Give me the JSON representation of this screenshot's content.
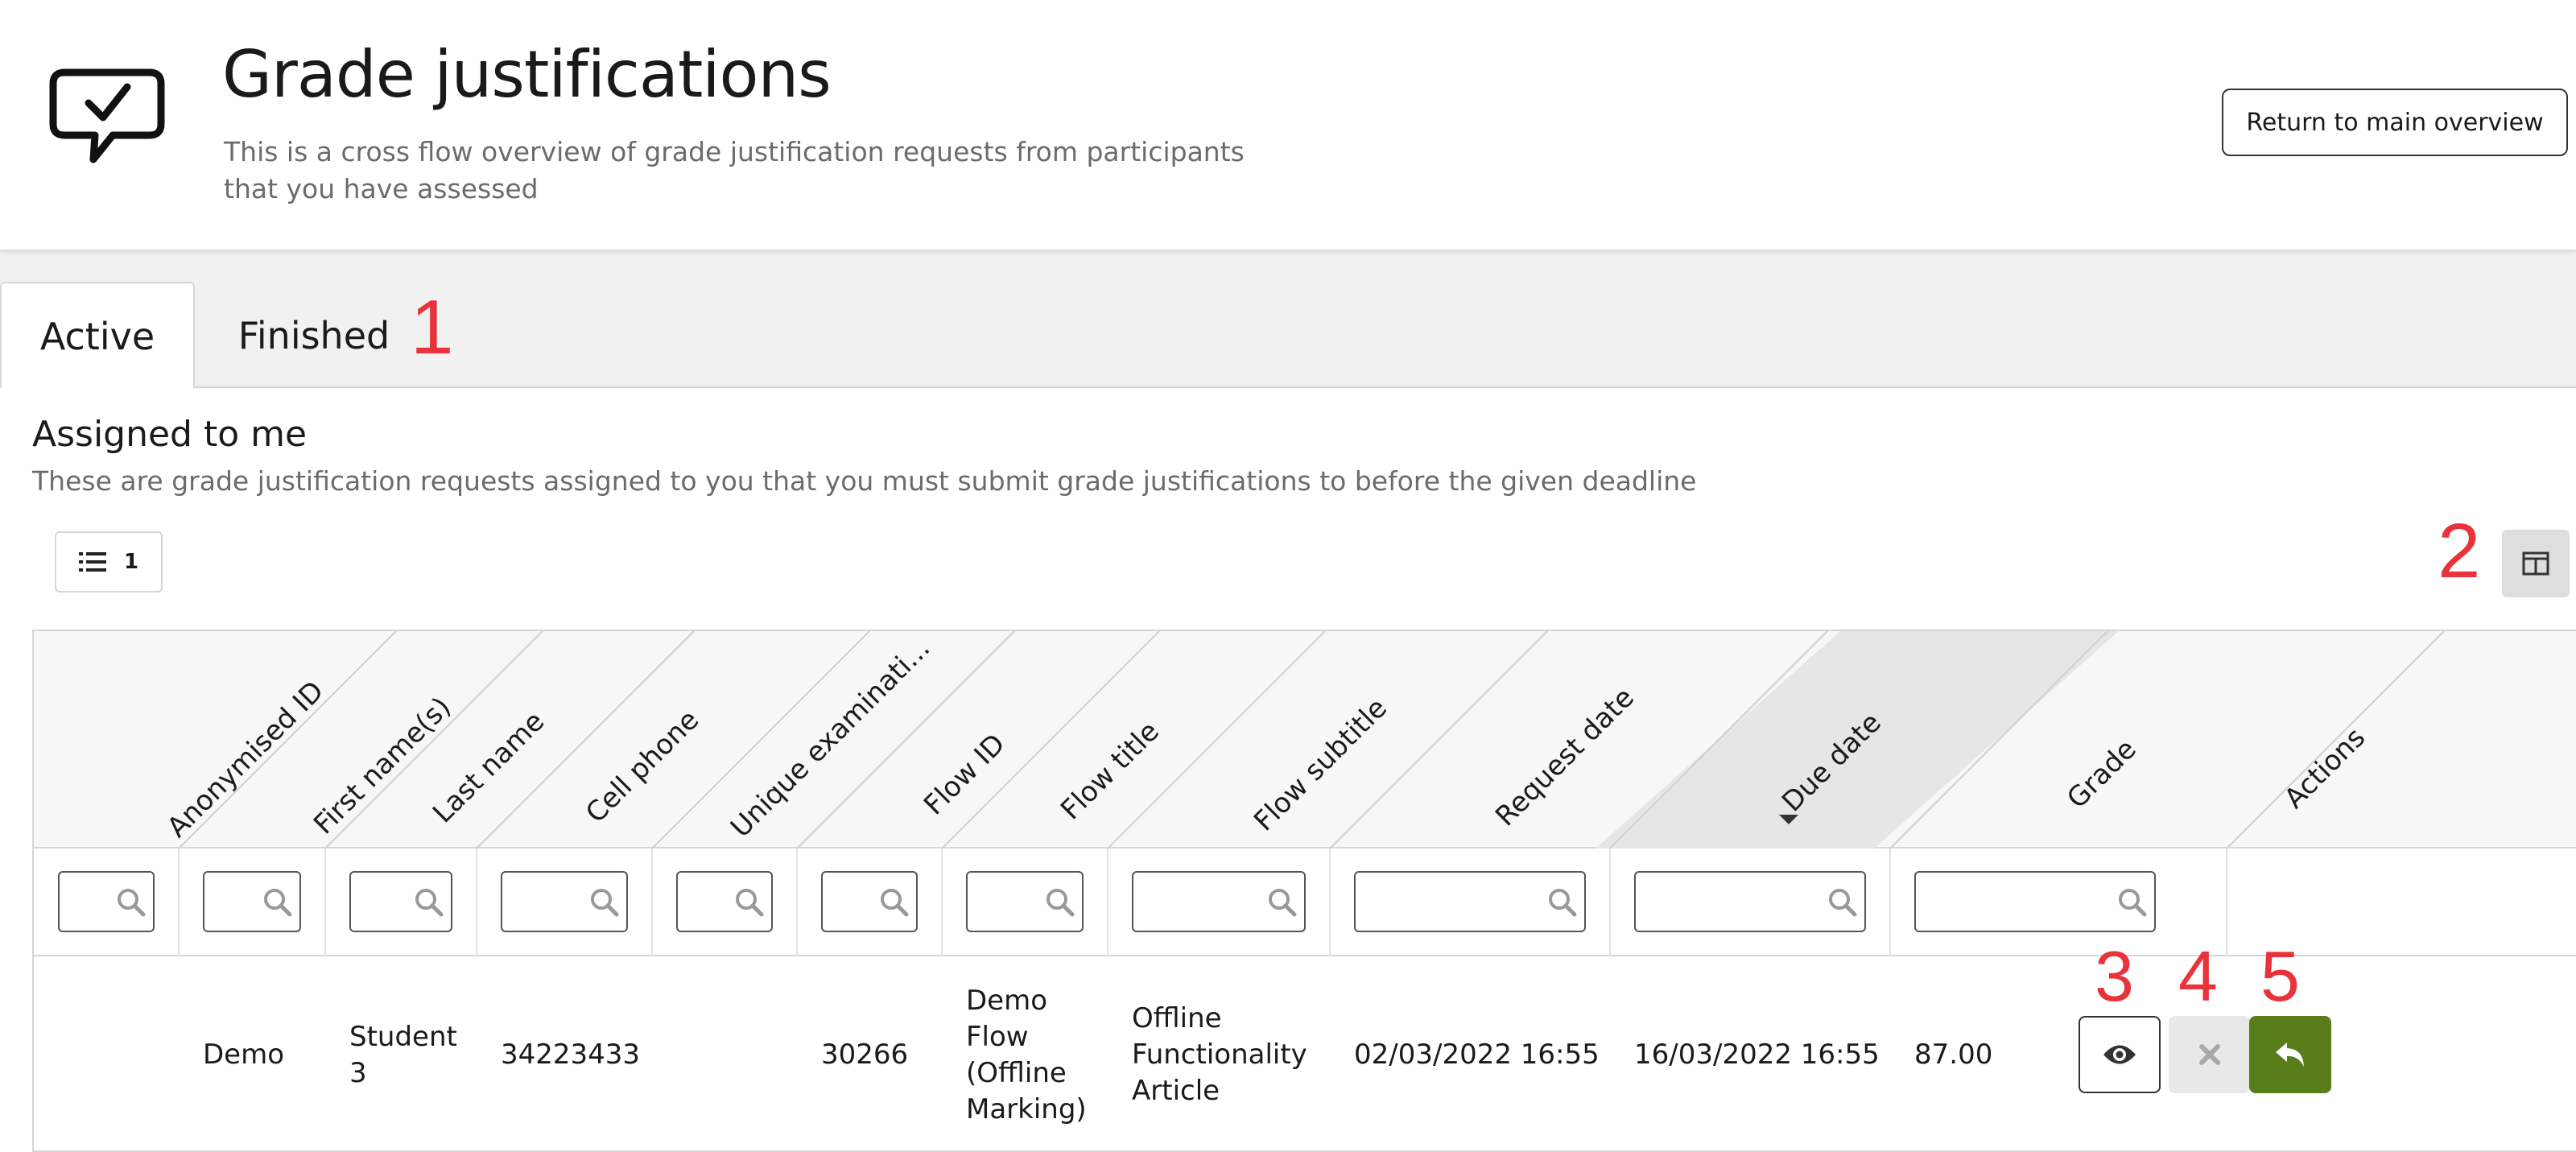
{
  "header": {
    "icon": "speech-bubble-check-icon",
    "title": "Grade justifications",
    "subtitle_line1": "This is a cross flow overview of grade justification requests from participants",
    "subtitle_line2": "that you have assessed",
    "return_button": "Return to main overview"
  },
  "tabs": [
    {
      "label": "Active",
      "active": true
    },
    {
      "label": "Finished",
      "active": false
    }
  ],
  "annotations": [
    "1",
    "2",
    "3",
    "4",
    "5"
  ],
  "section": {
    "title": "Assigned to me",
    "subtitle": "These are grade justification requests assigned to you that you must submit grade justifications to before the given deadline"
  },
  "toolbar": {
    "list_icon": "list-icon",
    "list_count": "1",
    "layout_icon": "columns-layout-icon"
  },
  "table": {
    "columns": [
      "Anonymised ID",
      "First name(s)",
      "Last name",
      "Cell phone",
      "Unique examinati...",
      "Flow ID",
      "Flow title",
      "Flow subtitle",
      "Request date",
      "Due date",
      "Grade",
      "Actions"
    ],
    "sorted_column": "Due date",
    "sort_direction": "descending",
    "rows": [
      {
        "anonymised_id": "",
        "first_name": "Demo",
        "last_name": "Student 3",
        "cell_phone": "34223433",
        "unique_exam": "",
        "flow_id": "30266",
        "flow_title": "Demo Flow (Offline Marking)",
        "flow_subtitle": "Offline Functionality Article",
        "request_date": "02/03/2022 16:55",
        "due_date": "16/03/2022 16:55",
        "grade": "87.00",
        "actions": [
          "eye-icon",
          "close-icon",
          "reply-arrow-icon"
        ]
      }
    ]
  },
  "colors": {
    "accent_green": "#5a7d1c",
    "annotation_red": "#e8333c",
    "sorted_header_bg": "#e6e6e6"
  }
}
